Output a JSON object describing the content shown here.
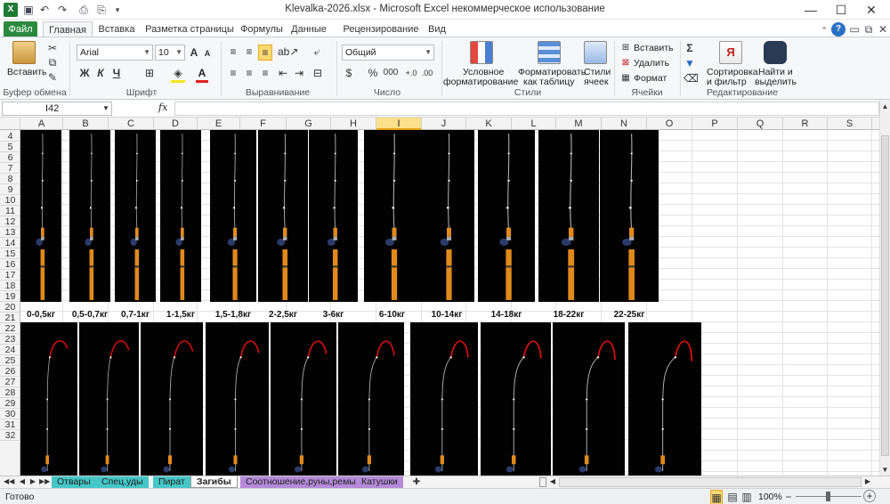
{
  "window": {
    "title": "Klevalka-2026.xlsx  -  Microsoft Excel некоммерческое использование"
  },
  "ribbon_tabs": [
    "Файл",
    "Главная",
    "Вставка",
    "Разметка страницы",
    "Формулы",
    "Данные",
    "Рецензирование",
    "Вид"
  ],
  "ribbon": {
    "clipboard": {
      "paste": "Вставить",
      "group": "Буфер обмена"
    },
    "font": {
      "name": "Arial",
      "size": "10",
      "bold": "Ж",
      "italic": "К",
      "underline": "Ч",
      "grow": "A",
      "shrink": "A",
      "color_letter": "A",
      "group": "Шрифт"
    },
    "alignment": {
      "group": "Выравнивание"
    },
    "number": {
      "format": "Общий",
      "percent": "%",
      "thousands": "000",
      "group": "Число"
    },
    "styles": {
      "conditional": "Условное\nформатирование",
      "conditional_l1": "Условное",
      "conditional_l2": "форматирование",
      "table_l1": "Форматировать",
      "table_l2": "как таблицу",
      "cell_l1": "Стили",
      "cell_l2": "ячеек",
      "group": "Стили"
    },
    "cells": {
      "insert": "Вставить",
      "delete": "Удалить",
      "format": "Формат",
      "group": "Ячейки"
    },
    "editing": {
      "sort_l1": "Сортировка",
      "sort_l2": "и фильтр",
      "find_l1": "Найти и",
      "find_l2": "выделить",
      "sigma": "Σ",
      "group": "Редактирование"
    }
  },
  "formula_bar": {
    "name_box": "I42",
    "fx": "fx",
    "formula": ""
  },
  "grid": {
    "selected_column": "I",
    "columns": [
      "A",
      "B",
      "C",
      "D",
      "E",
      "F",
      "G",
      "H",
      "I",
      "J",
      "K",
      "L",
      "M",
      "N",
      "O",
      "P",
      "Q",
      "R",
      "S"
    ],
    "rows": [
      "4",
      "5",
      "6",
      "7",
      "8",
      "9",
      "10",
      "11",
      "12",
      "13",
      "14",
      "15",
      "16",
      "17",
      "18",
      "19",
      "20",
      "21",
      "22",
      "23",
      "24",
      "25",
      "26",
      "27",
      "28",
      "29",
      "30",
      "31",
      "32"
    ],
    "weight_labels": [
      "0-0,5кг",
      "0,5-0,7кг",
      "0,7-1кг",
      "1-1,5кг",
      "1,5-1,8кг",
      "2-2,5кг",
      "3-6кг",
      "6-10кг",
      "10-14кг",
      "14-18кг",
      "18-22кг",
      "22-25кг"
    ]
  },
  "sheet_tabs": [
    "Отвары",
    "Спец.уды",
    "Пират",
    "Загибы",
    "Соотношение,руны,ремы",
    "Катушки"
  ],
  "active_sheet": "Загибы",
  "status": {
    "ready": "Готово",
    "zoom": "100%",
    "minus": "−",
    "plus": "+"
  },
  "colors": {
    "file_tab": "#2a8a3e",
    "selected_header": "#fde08a",
    "bend_red": "#d01010",
    "rod_handle": "#e08a1c"
  }
}
